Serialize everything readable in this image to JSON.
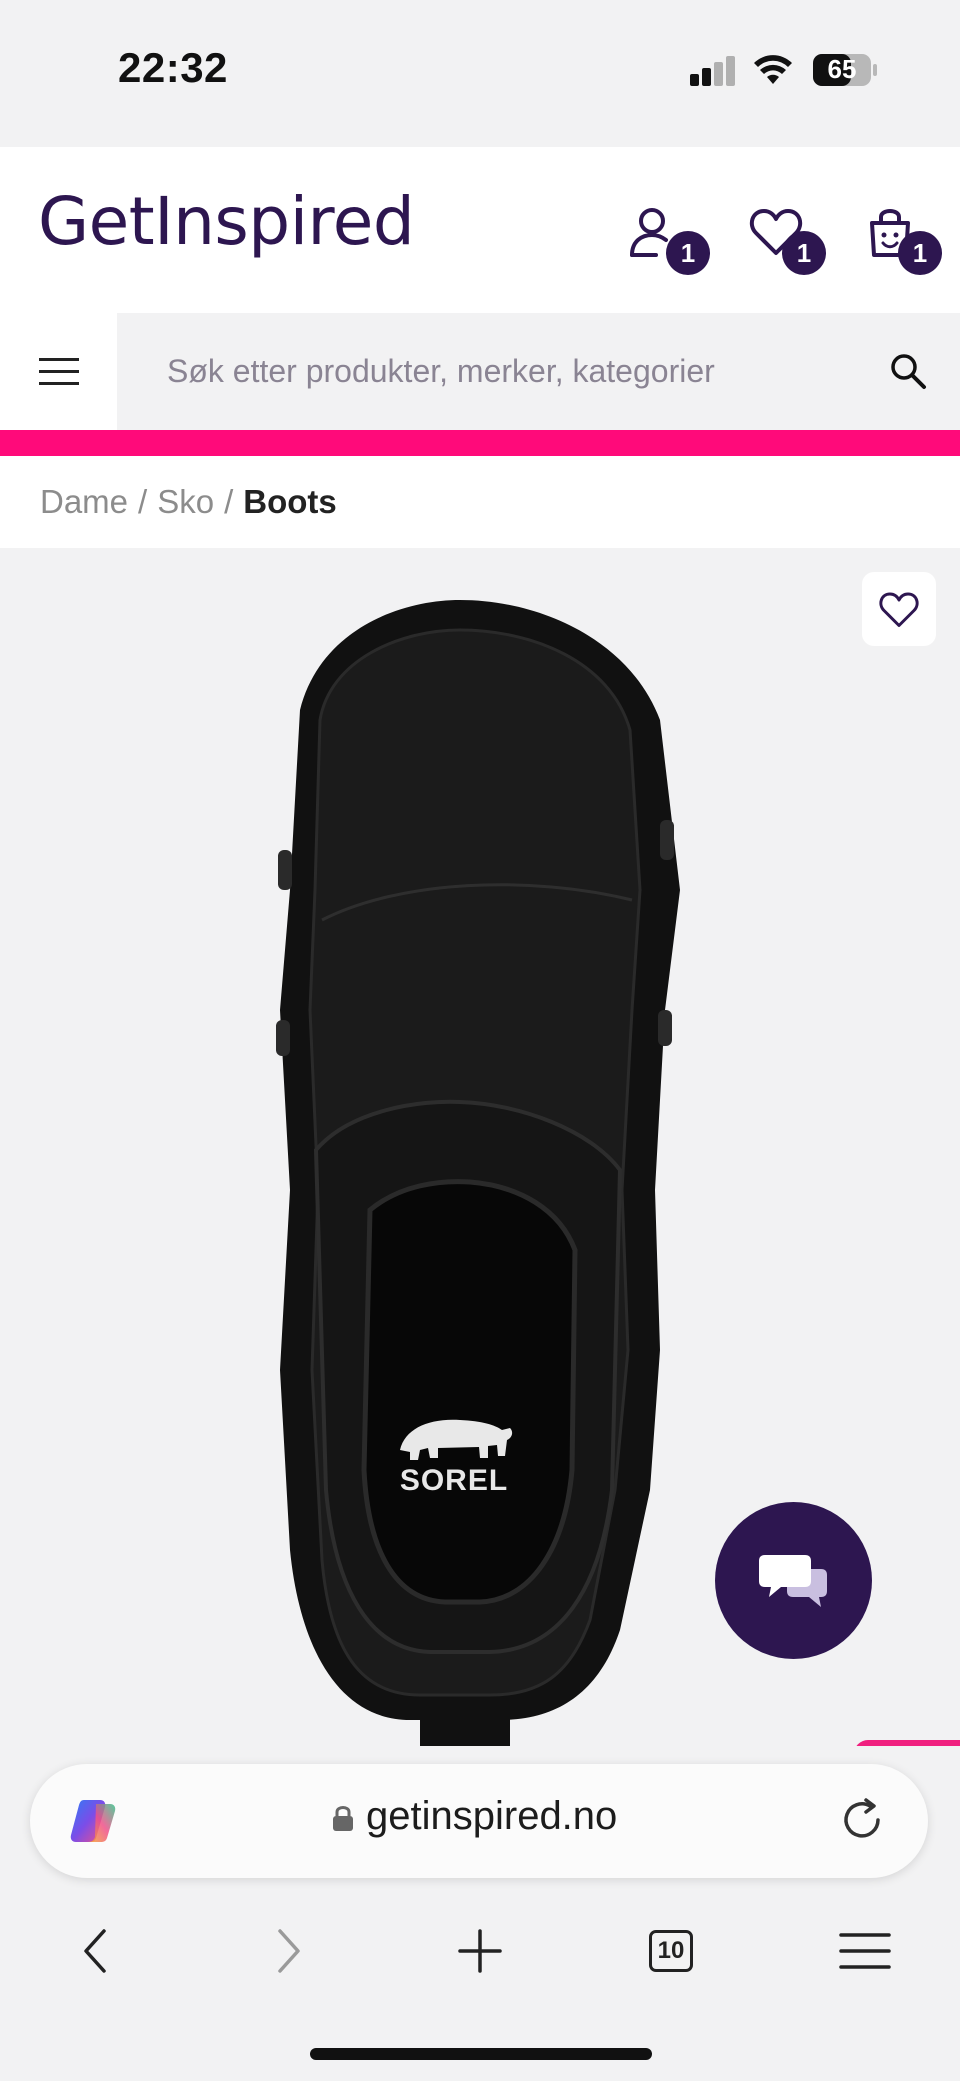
{
  "status_bar": {
    "time": "22:32",
    "battery": "65"
  },
  "header": {
    "logo": "GetInspired",
    "account_badge": "1",
    "wishlist_badge": "1",
    "cart_badge": "1"
  },
  "search": {
    "placeholder": "Søk etter produkter, merker, kategorier"
  },
  "breadcrumb": {
    "items": [
      "Dame",
      "Sko"
    ],
    "separator": "/",
    "current": "Boots"
  },
  "product": {
    "brand_print": "SOREL"
  },
  "browser": {
    "url": "getinspired.no",
    "tab_count": "10"
  },
  "colors": {
    "brand_purple": "#2d1650",
    "accent_pink": "#ff0a7a",
    "background": "#f2f2f3"
  },
  "icons": [
    "signal-icon",
    "wifi-icon",
    "battery-icon",
    "account-icon",
    "heart-icon",
    "cart-icon",
    "hamburger-icon",
    "search-icon",
    "chat-icon",
    "copilot-icon",
    "lock-icon",
    "reload-icon",
    "back-icon",
    "forward-icon",
    "plus-icon",
    "tabs-icon",
    "browser-menu-icon"
  ]
}
